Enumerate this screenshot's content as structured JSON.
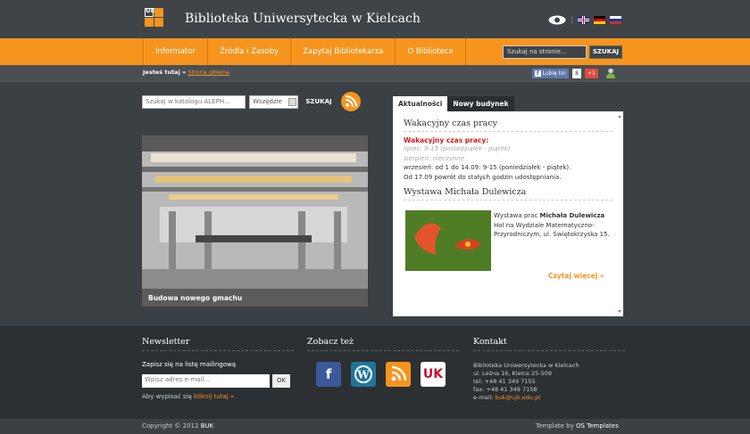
{
  "header": {
    "site_title": "Biblioteka Uniwersytecka w Kielcach",
    "logo_text": "UK"
  },
  "nav": {
    "items": [
      {
        "label": "Informator"
      },
      {
        "label": "Źródła i Zasoby"
      },
      {
        "label": "Zapytaj Bibliotekarza"
      },
      {
        "label": "O Bibliotece"
      }
    ],
    "search_placeholder": "Szukaj na stronie...",
    "search_button": "SZUKAJ"
  },
  "breadcrumb": {
    "prefix": "Jesteś tutaj »",
    "current": "Strona główna"
  },
  "social": {
    "like_label": "Lubię to!",
    "like_count": "8",
    "gplus_label": "+1"
  },
  "catalog": {
    "search_placeholder": "Szukaj w katalogu ALEPH...",
    "select_value": "Wszędzie",
    "search_button": "SZUKAJ"
  },
  "photo": {
    "caption": "Budowa nowego gmachu"
  },
  "tabs": [
    {
      "label": "Aktualności",
      "active": true
    },
    {
      "label": "Nowy budynek",
      "active": false
    }
  ],
  "news": {
    "heading1": "Wakacyjny czas pracy",
    "hours_title": "Wakacyjny czas pracy:",
    "line_july": "lipiec: 9-15 (poniedziałek - piątek)",
    "line_august": "sierpień: nieczynne",
    "line_sept_prefix": "wrzesień",
    "line_sept": ": od 1 do 14.09: 9-15 (poniedziałek - piątek).",
    "line_return": "Od 17.09 powrót do stałych godzin udostępniania.",
    "heading2": "Wystawa Michała Dulewicza",
    "exhib_pre": "Wystawa prac ",
    "exhib_name": "Michała Dulewicza",
    "exhib_post": " Hol na Wydziale Matematyczno-Przyrodniczym, ul. Świętokrzyska 15.",
    "more": "Czytaj więcej »"
  },
  "footer": {
    "newsletter_heading": "Newsletter",
    "newsletter_text": "Zapisz się na listę mailingową",
    "email_placeholder": "Wpisz adres e-mail...",
    "ok_button": "OK",
    "unsub_text": "Aby wypisać się ",
    "unsub_link": "kliknij tutaj »",
    "see_also_heading": "Zobacz też",
    "contact_heading": "Kontakt",
    "contact_lines": [
      "Biblioteka Uniwersytecka w Kielcach",
      "ul. Leśna 16, Kielce 25-509",
      "tel: +48 41 349 7155",
      "fax: +48 41 349 7158"
    ],
    "email_label": "e-mail: ",
    "email": "buk@ujk.edu.pl",
    "copyright": "Copyright © 2012 ",
    "copyright_owner": "BUK",
    "template_by": "Template by ",
    "template_author": "OS Templates"
  }
}
